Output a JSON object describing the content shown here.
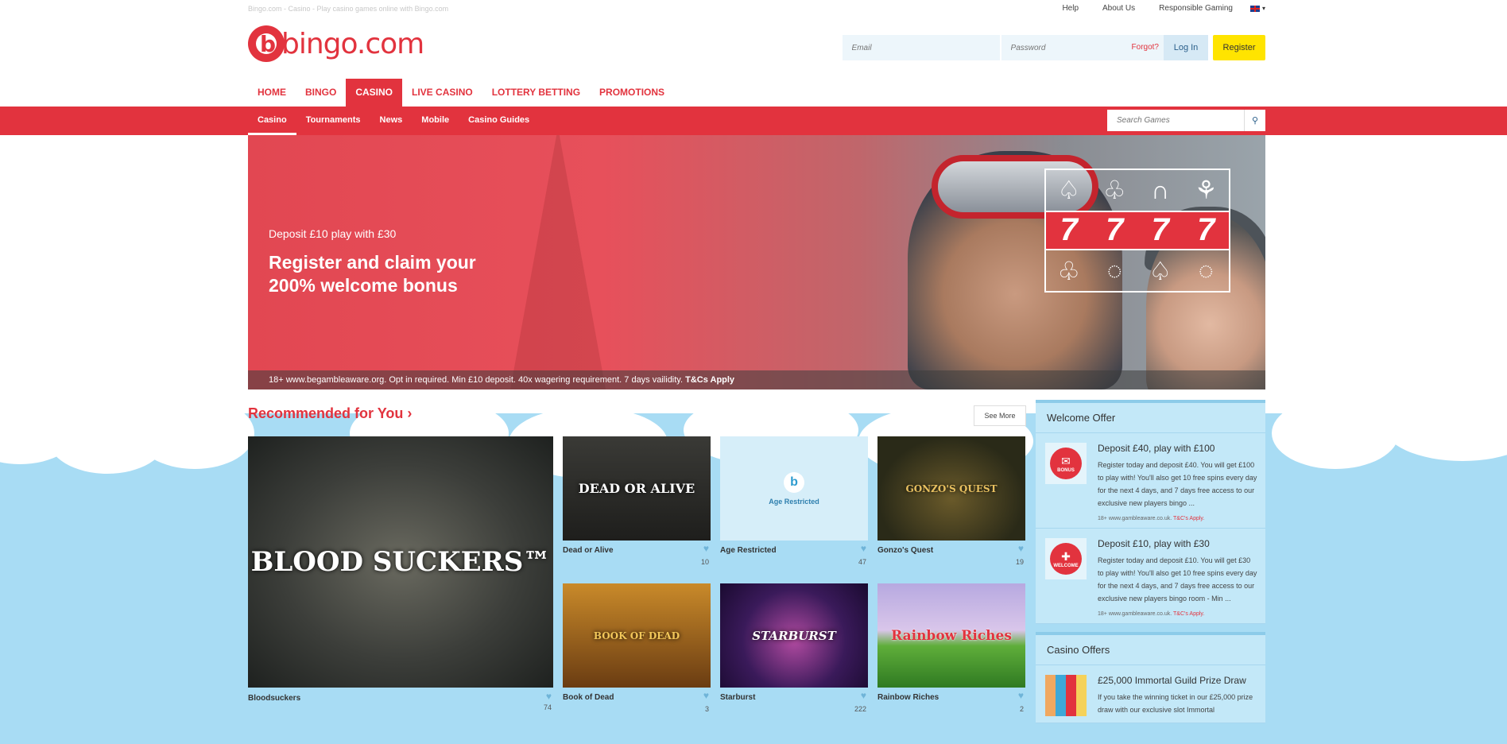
{
  "topbar": {
    "tagline": "Bingo.com - Casino - Play casino games online with Bingo.com",
    "links": [
      "Help",
      "About Us",
      "Responsible Gaming"
    ]
  },
  "header": {
    "logo_text": "bingo.com",
    "email_placeholder": "Email",
    "password_placeholder": "Password",
    "forgot": "Forgot?",
    "login": "Log In",
    "register": "Register"
  },
  "mainnav": [
    "HOME",
    "BINGO",
    "CASINO",
    "LIVE CASINO",
    "LOTTERY BETTING",
    "PROMOTIONS"
  ],
  "subnav": [
    "Casino",
    "Tournaments",
    "News",
    "Mobile",
    "Casino Guides"
  ],
  "search": {
    "placeholder": "Search Games"
  },
  "hero": {
    "small": "Deposit £10 play with £30",
    "big": "Register and claim your 200% welcome bonus",
    "terms": "18+ www.begambleaware.org. Opt in required. Min £10 deposit. 40x wagering requirement. 7 days vailidity.",
    "terms_link": "T&Cs Apply"
  },
  "recommended": {
    "title": "Recommended for You ›",
    "see_more": "See More",
    "games": [
      {
        "name": "Bloodsuckers",
        "likes": "74",
        "thumb_title": "BLOOD SUCKERS™"
      },
      {
        "name": "Dead or Alive",
        "likes": "10",
        "thumb_title": "DEAD OR ALIVE"
      },
      {
        "name": "Age Restricted",
        "likes": "47",
        "thumb_title": "Age Restricted"
      },
      {
        "name": "Gonzo's Quest",
        "likes": "19",
        "thumb_title": "GONZO'S QUEST"
      },
      {
        "name": "Book of Dead",
        "likes": "3",
        "thumb_title": "BOOK OF DEAD"
      },
      {
        "name": "Starburst",
        "likes": "222",
        "thumb_title": "STARBURST"
      },
      {
        "name": "Rainbow Riches",
        "likes": "2",
        "thumb_title": "Rainbow Riches"
      }
    ]
  },
  "sidebar": {
    "welcome_title": "Welcome Offer",
    "offers": [
      {
        "badge": "BONUS",
        "title": "Deposit £40, play with £100",
        "desc": "Register today and deposit £40. You will get £100 to play with! You'll also get 10 free spins every day for the next 4 days, and 7 days free access to our exclusive new players bingo ...",
        "foot": "18+ www.gambleaware.co.uk.",
        "foot_link": "T&C's Apply."
      },
      {
        "badge": "WELCOME",
        "title": "Deposit £10, play with £30",
        "desc": "Register today and deposit £10. You will get £30 to play with! You'll also get 10 free spins every day for the next 4 days, and 7 days free access to our exclusive new players bingo room - Min ...",
        "foot": "18+ www.gambleaware.co.uk.",
        "foot_link": "T&C's Apply."
      }
    ],
    "casino_title": "Casino Offers",
    "casino_offer": {
      "title": "£25,000 Immortal Guild Prize Draw",
      "desc": "If you take the winning ticket in our £25,000 prize draw with our exclusive slot Immortal"
    }
  }
}
